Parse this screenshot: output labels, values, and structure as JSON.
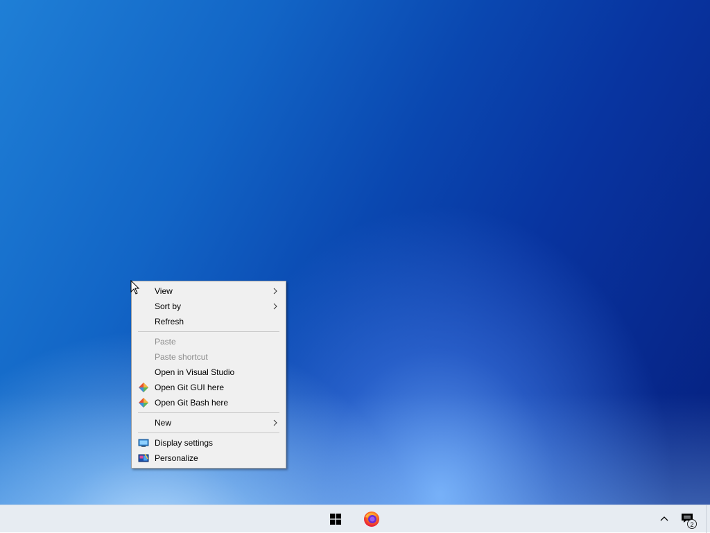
{
  "context_menu": {
    "items": [
      {
        "label": "View",
        "submenu": true,
        "disabled": false
      },
      {
        "label": "Sort by",
        "submenu": true,
        "disabled": false
      },
      {
        "label": "Refresh",
        "submenu": false,
        "disabled": false
      },
      {
        "label": "Paste",
        "submenu": false,
        "disabled": true
      },
      {
        "label": "Paste shortcut",
        "submenu": false,
        "disabled": true
      },
      {
        "label": "Open in Visual Studio",
        "submenu": false,
        "disabled": false
      },
      {
        "label": "Open Git GUI here",
        "submenu": false,
        "disabled": false,
        "icon": "git-icon"
      },
      {
        "label": "Open Git Bash here",
        "submenu": false,
        "disabled": false,
        "icon": "git-icon"
      },
      {
        "label": "New",
        "submenu": true,
        "disabled": false
      },
      {
        "label": "Display settings",
        "submenu": false,
        "disabled": false,
        "icon": "display-icon"
      },
      {
        "label": "Personalize",
        "submenu": false,
        "disabled": false,
        "icon": "personalize-icon"
      }
    ]
  },
  "taskbar": {
    "pinned": [
      {
        "name": "start-button",
        "icon": "windows-logo-icon"
      },
      {
        "name": "firefox",
        "icon": "firefox-icon"
      }
    ],
    "tray": {
      "chevron_icon": "chevron-up-icon",
      "notification_icon": "action-center-icon",
      "notification_count": "2"
    }
  },
  "colors": {
    "menu_bg": "#f0f0f0",
    "disabled_text": "#8c8c8c",
    "taskbar_bg": "#e7ecf2"
  }
}
